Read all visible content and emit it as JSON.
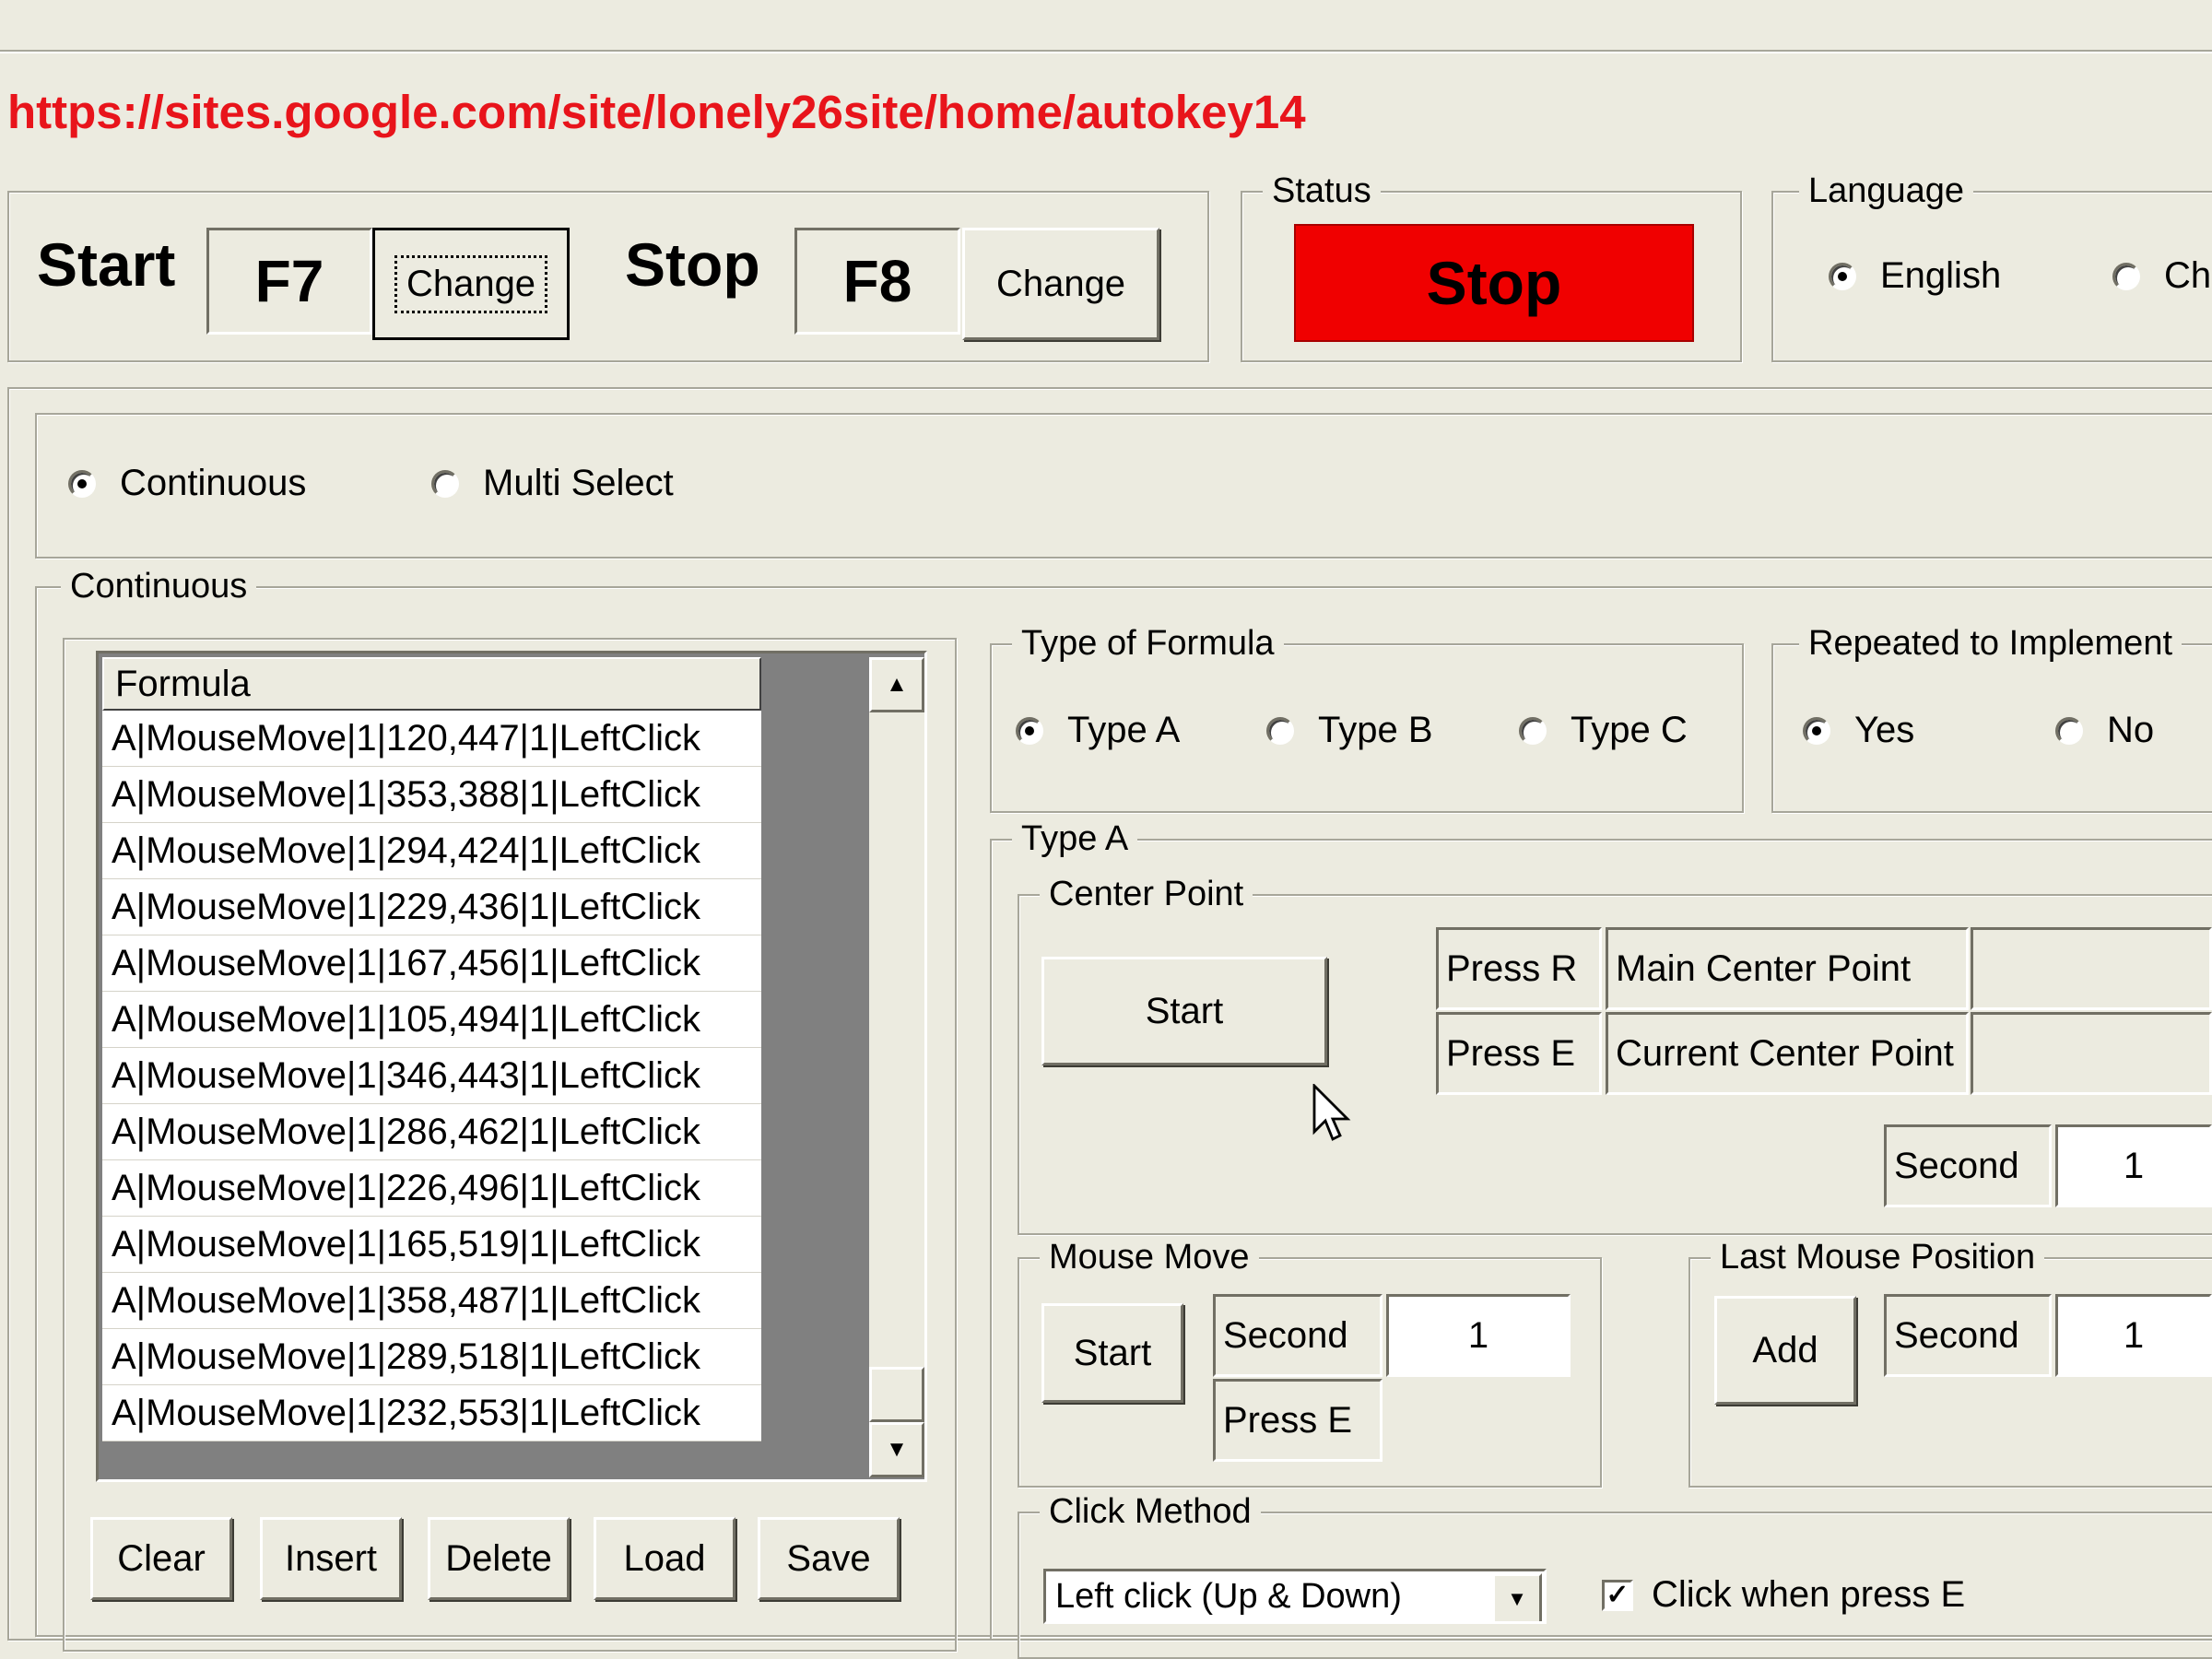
{
  "url": "https://sites.google.com/site/lonely26site/home/autokey14",
  "hotkeys": {
    "start_label": "Start",
    "start_key": "F7",
    "start_change": "Change",
    "stop_label": "Stop",
    "stop_key": "F8",
    "stop_change": "Change"
  },
  "status": {
    "legend": "Status",
    "value": "Stop",
    "color": "#f00000"
  },
  "language": {
    "legend": "Language",
    "options": [
      "English",
      "Ch"
    ],
    "selected": "English"
  },
  "mode": {
    "options": [
      "Continuous",
      "Multi Select"
    ],
    "selected": "Continuous"
  },
  "continuous": {
    "legend": "Continuous",
    "list": {
      "header": "Formula",
      "rows": [
        "A|MouseMove|1|120,447|1|LeftClick",
        "A|MouseMove|1|353,388|1|LeftClick",
        "A|MouseMove|1|294,424|1|LeftClick",
        "A|MouseMove|1|229,436|1|LeftClick",
        "A|MouseMove|1|167,456|1|LeftClick",
        "A|MouseMove|1|105,494|1|LeftClick",
        "A|MouseMove|1|346,443|1|LeftClick",
        "A|MouseMove|1|286,462|1|LeftClick",
        "A|MouseMove|1|226,496|1|LeftClick",
        "A|MouseMove|1|165,519|1|LeftClick",
        "A|MouseMove|1|358,487|1|LeftClick",
        "A|MouseMove|1|289,518|1|LeftClick",
        "A|MouseMove|1|232,553|1|LeftClick"
      ]
    },
    "buttons": [
      "Clear",
      "Insert",
      "Delete",
      "Load",
      "Save"
    ]
  },
  "type_of_formula": {
    "legend": "Type of Formula",
    "options": [
      "Type A",
      "Type B",
      "Type C"
    ],
    "selected": "Type A"
  },
  "repeated": {
    "legend": "Repeated to Implement",
    "options": [
      "Yes",
      "No"
    ],
    "selected": "Yes"
  },
  "type_a": {
    "legend": "Type A",
    "center_point": {
      "legend": "Center Point",
      "start": "Start",
      "press_r": "Press R",
      "main_center": "Main Center Point",
      "press_e": "Press E",
      "current_center": "Current Center Point",
      "second_label": "Second",
      "second_value": "1"
    },
    "mouse_move": {
      "legend": "Mouse Move",
      "start": "Start",
      "second_label": "Second",
      "second_value": "1",
      "press_e": "Press E"
    },
    "last_mouse": {
      "legend": "Last Mouse Position",
      "add": "Add",
      "second_label": "Second",
      "second_value": "1"
    },
    "click_method": {
      "legend": "Click Method",
      "selected": "Left click (Up & Down)",
      "checkbox_label": "Click when press E",
      "checked": true
    }
  }
}
